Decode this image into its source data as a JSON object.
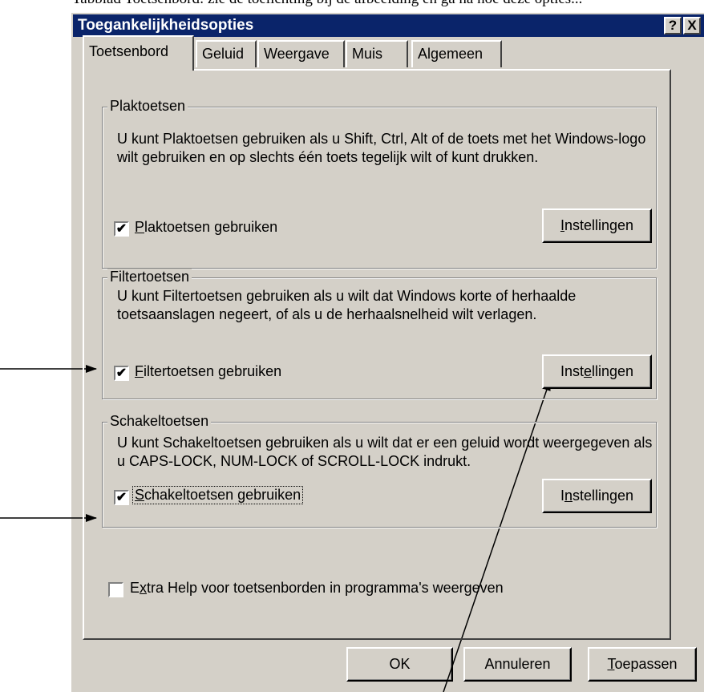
{
  "caption": "Tabblad Toetsenbord: zie de toelichting bij de afbeelding en ga na hoe deze opties...",
  "window": {
    "title": "Toegankelijkheidsopties",
    "help_button": "?",
    "close_button": "X"
  },
  "tabs": [
    {
      "label": "Toetsenbord",
      "active": true
    },
    {
      "label": "Geluid",
      "active": false
    },
    {
      "label": "Weergave",
      "active": false
    },
    {
      "label": "Muis",
      "active": false
    },
    {
      "label": "Algemeen",
      "active": false
    }
  ],
  "groups": {
    "sticky": {
      "title": "Plaktoetsen",
      "description": "U kunt Plaktoetsen gebruiken als u Shift, Ctrl, Alt of de toets met het Windows-logo wilt gebruiken en op slechts één toets tegelijk wilt of kunt drukken.",
      "checkbox": {
        "checked": true,
        "accel": "P",
        "label_rest": "laktoetsen gebruiken"
      },
      "button": {
        "pre": "",
        "accel": "I",
        "post": "nstellingen"
      }
    },
    "filter": {
      "title": "Filtertoetsen",
      "description": "U kunt Filtertoetsen gebruiken als u wilt dat Windows korte of herhaalde toetsaanslagen negeert, of als u de herhaalsnelheid wilt verlagen.",
      "checkbox": {
        "checked": true,
        "accel": "F",
        "label_rest": "iltertoetsen gebruiken"
      },
      "button": {
        "pre": "Inst",
        "accel": "e",
        "post": "llingen"
      }
    },
    "toggle": {
      "title": "Schakeltoetsen",
      "description": "U kunt Schakeltoetsen gebruiken als u wilt dat er een geluid wordt weergegeven als u CAPS-LOCK, NUM-LOCK of SCROLL-LOCK indrukt.",
      "checkbox": {
        "checked": true,
        "accel": "S",
        "label_rest": "chakeltoetsen gebruiken"
      },
      "button": {
        "pre": "I",
        "accel": "n",
        "post": "stellingen"
      }
    }
  },
  "extra_help": {
    "checked": false,
    "pre": "E",
    "accel": "x",
    "post": "tra Help voor toetsenborden in programma's weergeven"
  },
  "footer": {
    "ok": "OK",
    "cancel": "Annuleren",
    "apply_accel": "T",
    "apply_rest": "oepassen"
  },
  "check_glyph": "✔"
}
